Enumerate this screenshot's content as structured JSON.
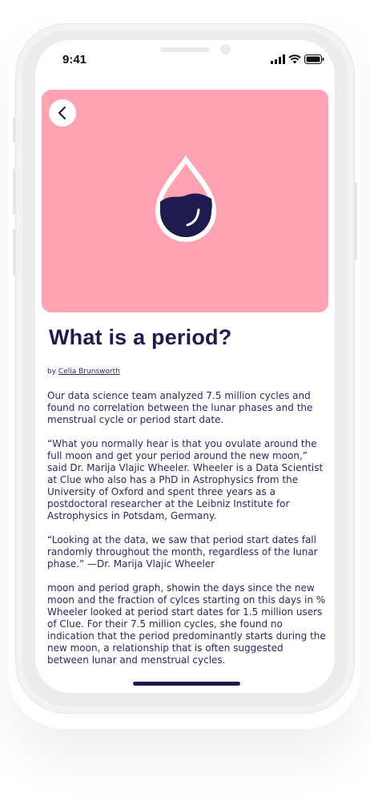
{
  "status_bar": {
    "time": "9:41",
    "icons": [
      "signal-icon",
      "wifi-icon",
      "battery-icon"
    ]
  },
  "hero": {
    "background_color": "#ffa3b2",
    "icon": "drop-icon",
    "back_icon": "chevron-left-icon"
  },
  "article": {
    "title": "What is a period?",
    "byline_prefix": "by",
    "author": "Celia Brunsworth",
    "paragraphs": [
      "Our data science team analyzed 7.5 million cycles and found no correlation between the lunar phases and the menstrual cycle or period start date.",
      "“What you normally hear is that you ovulate around the full moon and get your period around the new moon,” said Dr. Marija Vlajic Wheeler. Wheeler is a Data Scientist at Clue who also has a PhD in Astrophysics from the University of Oxford and spent three years as a postdoctoral researcher at the Leibniz Institute for Astrophysics in Potsdam, Germany.",
      "“Looking at the data, we saw that period start dates fall randomly throughout the month, regardless of the lunar phase.” —Dr. Marija Vlajic Wheeler",
      "moon and period graph, showin the days since the new moon and the fraction of cylces starting on this days in %",
      "Wheeler looked at period start dates for 1.5 million users of Clue. For their 7.5 million cycles, she found no indication that the period predominantly starts during the new moon, a relationship that is often suggested between lunar and menstrual cycles."
    ]
  },
  "colors": {
    "accent": "#1f1b4f",
    "text": "#2b2860"
  }
}
